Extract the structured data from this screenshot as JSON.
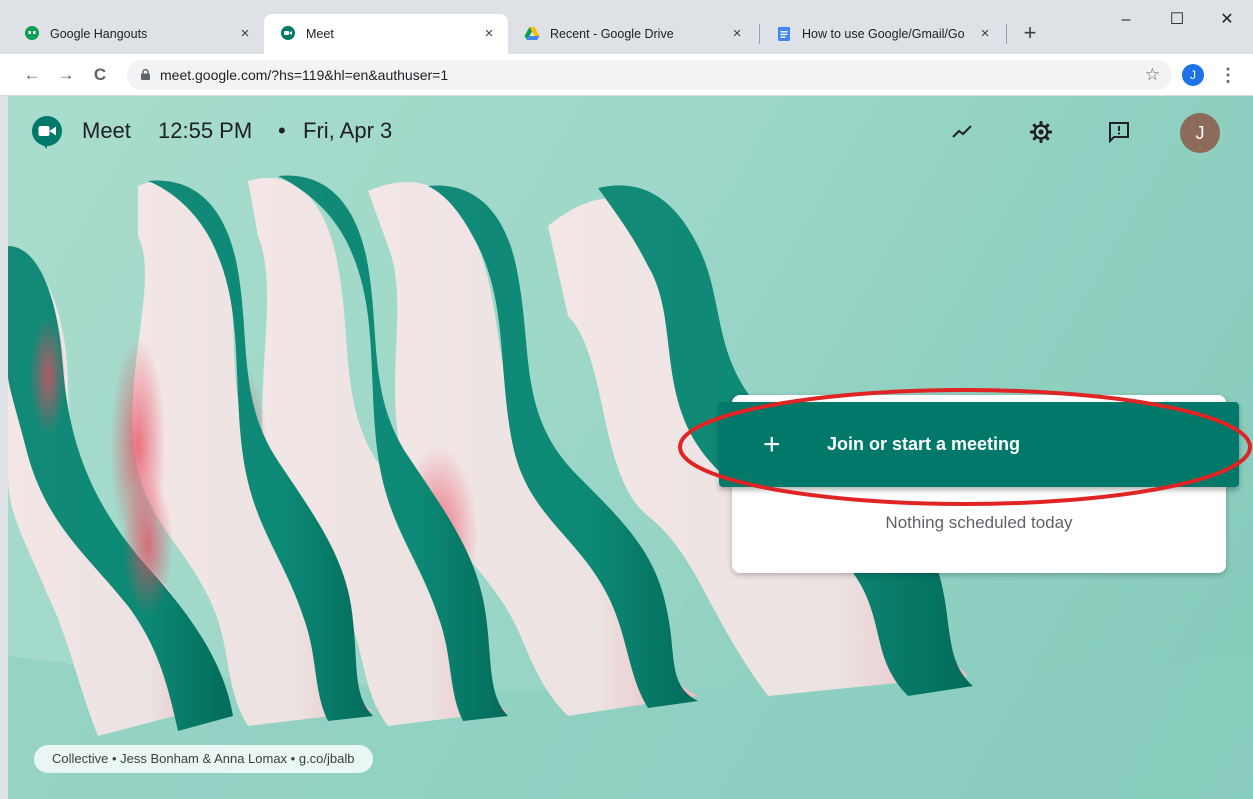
{
  "browser": {
    "tabs": [
      {
        "title": "Google Hangouts",
        "icon": "hangouts-icon",
        "active": false
      },
      {
        "title": "Meet",
        "icon": "meet-icon",
        "active": true
      },
      {
        "title": "Recent - Google Drive",
        "icon": "drive-icon",
        "active": false
      },
      {
        "title": "How to use Google/Gmail/Go",
        "icon": "docs-icon",
        "active": false
      }
    ],
    "close_glyph": "×",
    "new_tab_glyph": "+",
    "window_controls": {
      "minimize": "–",
      "maximize": "☐",
      "close": "✕"
    },
    "nav": {
      "back": "←",
      "forward": "→",
      "reload": "C"
    },
    "url": "meet.google.com/?hs=119&hl=en&authuser=1",
    "bookmark_glyph": "☆",
    "profile_initial": "J",
    "menu_glyph": "⋮"
  },
  "meet": {
    "app_name": "Meet",
    "time": "12:55 PM",
    "separator": "•",
    "date": "Fri, Apr 3",
    "avatar_initial": "J",
    "join_plus": "+",
    "join_label": "Join or start a meeting",
    "nothing_scheduled": "Nothing scheduled today",
    "credit": "Collective • Jess Bonham & Anna Lomax • g.co/jbalb"
  },
  "colors": {
    "meet_green": "#00796b",
    "highlight_red": "#e02424",
    "profile_blue": "#1a73e8",
    "avatar_brown": "#8d6b5a"
  }
}
